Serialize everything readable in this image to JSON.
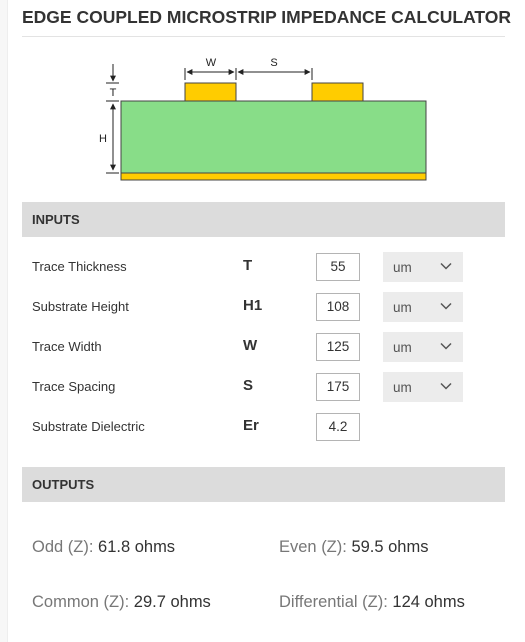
{
  "title": "EDGE COUPLED MICROSTRIP IMPEDANCE CALCULATOR",
  "diagram": {
    "labels": {
      "w": "W",
      "s": "S",
      "t": "T",
      "h": "H"
    },
    "colors": {
      "substrate": "#88dd88",
      "trace": "#ffcc00",
      "ground": "#ffcc00"
    }
  },
  "inputs_header": "INPUTS",
  "inputs": [
    {
      "label": "Trace Thickness",
      "symbol": "T",
      "value": "55",
      "unit": "um"
    },
    {
      "label": "Substrate Height",
      "symbol": "H1",
      "value": "108",
      "unit": "um"
    },
    {
      "label": "Trace Width",
      "symbol": "W",
      "value": "125",
      "unit": "um"
    },
    {
      "label": "Trace Spacing",
      "symbol": "S",
      "value": "175",
      "unit": "um"
    },
    {
      "label": "Substrate Dielectric",
      "symbol": "Er",
      "value": "4.2"
    }
  ],
  "outputs_header": "OUTPUTS",
  "outputs": {
    "odd": {
      "label": "Odd (Z): ",
      "value": "61.8 ohms"
    },
    "even": {
      "label": "Even (Z): ",
      "value": "59.5 ohms"
    },
    "common": {
      "label": "Common (Z): ",
      "value": "29.7 ohms"
    },
    "differential": {
      "label": "Differential (Z): ",
      "value": "124 ohms"
    }
  }
}
